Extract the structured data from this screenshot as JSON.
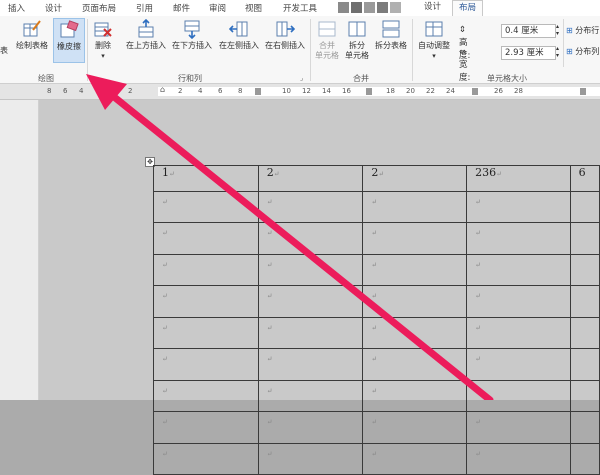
{
  "tabs": [
    "插入",
    "设计",
    "页面布局",
    "引用",
    "邮件",
    "审阅",
    "视图",
    "开发工具"
  ],
  "context_tabs": [
    "设计",
    "布局"
  ],
  "active_tab": "布局",
  "ribbon": {
    "draw_group": {
      "label": "绘图",
      "draw_table": "绘制表格",
      "eraser": "橡皮擦",
      "partial": "表"
    },
    "rows_cols_group": {
      "label": "行和列",
      "delete": "删除",
      "insert_above": "在上方插入",
      "insert_below": "在下方插入",
      "insert_left": "在左侧插入",
      "insert_right": "在右侧插入"
    },
    "merge_group": {
      "label": "合并",
      "merge_cells": "合并\n单元格",
      "split_cells": "拆分\n单元格",
      "split_table": "拆分表格"
    },
    "cell_size_group": {
      "label": "单元格大小",
      "autofit": "自动调整",
      "height_label": "高度:",
      "height_value": "0.4 厘米",
      "width_label": "宽度:",
      "width_value": "2.93 厘米",
      "distribute_rows": "分布行",
      "distribute_cols": "分布列"
    }
  },
  "ruler": {
    "marks": [
      "8",
      "6",
      "4",
      "2",
      "2",
      "4",
      "6",
      "8",
      "10",
      "12",
      "14",
      "16",
      "18",
      "20",
      "22",
      "24",
      "26",
      "28"
    ]
  },
  "table": {
    "header": [
      "1",
      "2",
      "2",
      "236",
      "6"
    ],
    "paragraph_mark": "↵",
    "empty_rows": 9
  },
  "colors": {
    "arrow": "#ec1c5b",
    "tab_accent": "#2b5797"
  }
}
